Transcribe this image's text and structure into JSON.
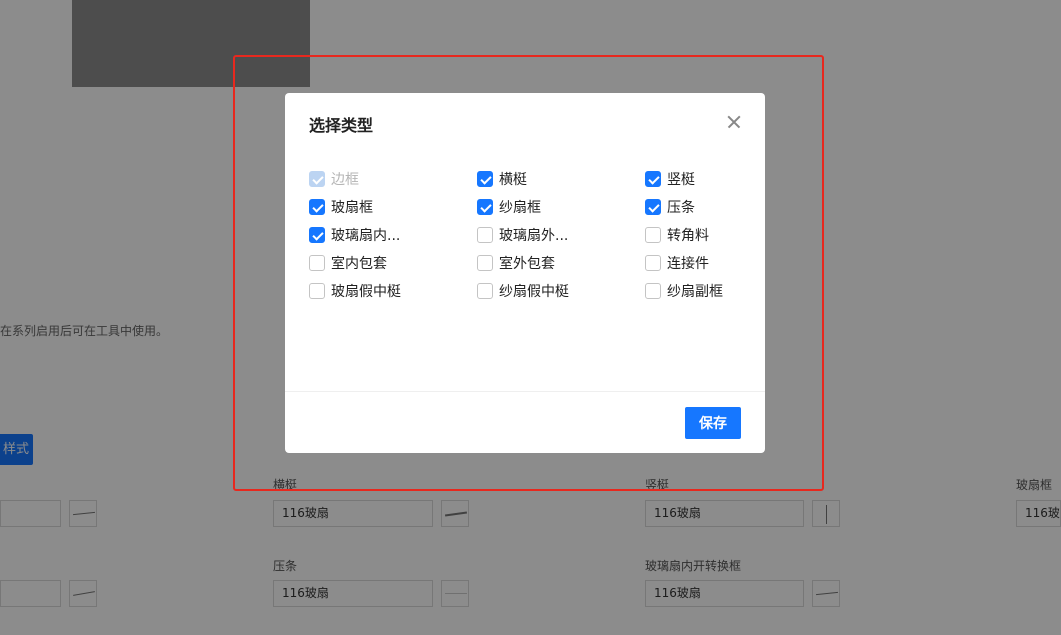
{
  "background": {
    "hint": "在系列启用后可在工具中使用。",
    "style_button_label": "样式",
    "fields": [
      {
        "label": "",
        "value": ""
      },
      {
        "label": "横梃",
        "value": "116玻扇"
      },
      {
        "label": "竖梃",
        "value": "116玻扇"
      },
      {
        "label": "玻扇框",
        "value": "116玻扇"
      },
      {
        "label": "",
        "value": ""
      },
      {
        "label": "压条",
        "value": "116玻扇"
      },
      {
        "label": "玻璃扇内开转换框",
        "value": "116玻扇"
      }
    ]
  },
  "modal": {
    "title": "选择类型",
    "save_label": "保存",
    "options": [
      {
        "label": "边框",
        "checked": true,
        "disabled": true
      },
      {
        "label": "横梃",
        "checked": true,
        "disabled": false
      },
      {
        "label": "竖梃",
        "checked": true,
        "disabled": false
      },
      {
        "label": "玻扇框",
        "checked": true,
        "disabled": false
      },
      {
        "label": "纱扇框",
        "checked": true,
        "disabled": false
      },
      {
        "label": "压条",
        "checked": true,
        "disabled": false
      },
      {
        "label": "玻璃扇内...",
        "checked": true,
        "disabled": false
      },
      {
        "label": "玻璃扇外...",
        "checked": false,
        "disabled": false
      },
      {
        "label": "转角料",
        "checked": false,
        "disabled": false
      },
      {
        "label": "室内包套",
        "checked": false,
        "disabled": false
      },
      {
        "label": "室外包套",
        "checked": false,
        "disabled": false
      },
      {
        "label": "连接件",
        "checked": false,
        "disabled": false
      },
      {
        "label": "玻扇假中梃",
        "checked": false,
        "disabled": false
      },
      {
        "label": "纱扇假中梃",
        "checked": false,
        "disabled": false
      },
      {
        "label": "纱扇副框",
        "checked": false,
        "disabled": false
      }
    ]
  },
  "colors": {
    "accent": "#1677ff",
    "highlight": "#e8281e"
  }
}
